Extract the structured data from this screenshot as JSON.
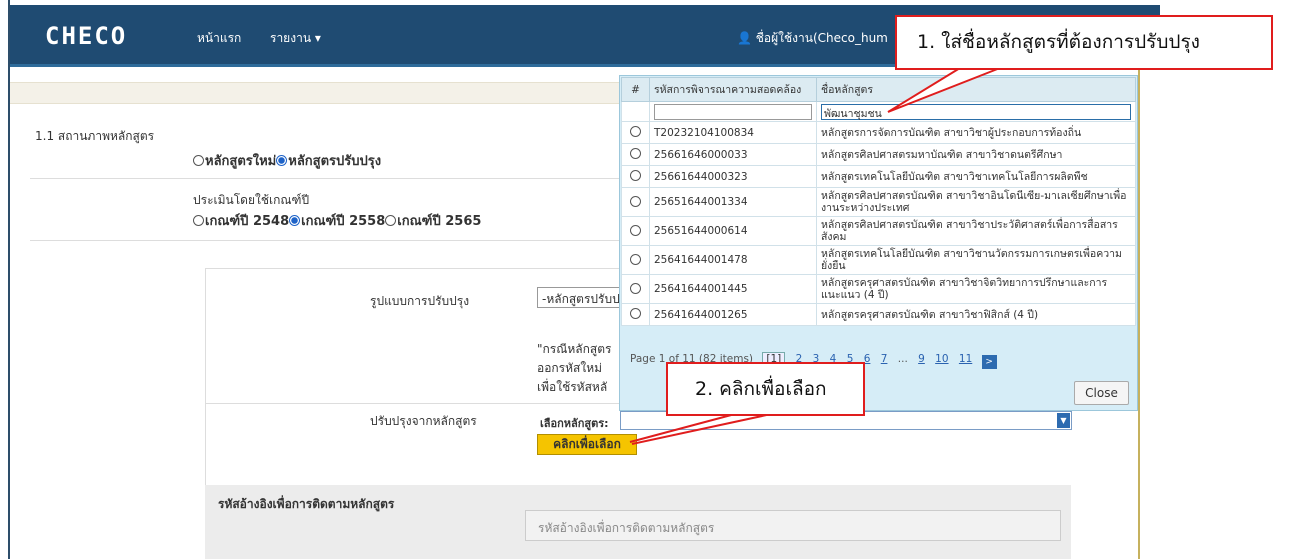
{
  "navbar": {
    "brand": "CHECO",
    "home": "หน้าแรก",
    "report": "รายงาน ▾",
    "user_text": "ชื่อผู้ใช้งาน(Checo_hum"
  },
  "form": {
    "status_label": "1.1 สถานภาพหลักสูตร",
    "status_new": "หลักสูตรใหม่",
    "status_revised": "หลักสูตรปรับปรุง",
    "criteria_label": "ประเมินโดยใช้เกณฑ์ปี",
    "criteria_options": [
      "เกณฑ์ปี 2548",
      "เกณฑ์ปี 2558",
      "เกณฑ์ปี 2565"
    ],
    "improve_type_label": "รูปแบบการปรับปรุง",
    "improve_type_value": "-หลักสูตรปรับป",
    "note_lines": [
      "\"กรณีหลักสูตร",
      "ออกรหัสใหม่ ",
      "เพื่อใช้รหัสหลั"
    ],
    "improve_from_label": "ปรับปรุงจากหลักสูตร",
    "pick_label": "เลือกหลักสูตร:",
    "pick_button": "คลิกเพื่อเลือก",
    "ref_label": "รหัสอ้างอิงเพื่อการติดตามหลักสูตร",
    "ref_placeholder": "รหัสอ้างอิงเพื่อการติดตามหลักสูตร"
  },
  "popup": {
    "headers": [
      "#",
      "รหัสการพิจารณาความสอดคล้อง",
      "ชื่อหลักสูตร"
    ],
    "filter_name_value": "พัฒนาชุมชน",
    "rows": [
      {
        "code": "T20232104100834",
        "name": "หลักสูตรการจัดการบัณฑิต สาขาวิชาผู้ประกอบการท้องถิ่น"
      },
      {
        "code": "25661646000033",
        "name": "หลักสูตรศิลปศาสตรมหาบัณฑิต สาขาวิชาดนตรีศึกษา"
      },
      {
        "code": "25661644000323",
        "name": "หลักสูตรเทคโนโลยีบัณฑิต สาขาวิชาเทคโนโลยีการผลิตพืช"
      },
      {
        "code": "25651644001334",
        "name": "หลักสูตรศิลปศาสตรบัณฑิต สาขาวิชาอินโดนีเซีย-มาเลเซียศึกษาเพื่องานระหว่างประเทศ"
      },
      {
        "code": "25651644000614",
        "name": "หลักสูตรศิลปศาสตรบัณฑิต สาขาวิชาประวัติศาสตร์เพื่อการสื่อสารสังคม"
      },
      {
        "code": "25641644001478",
        "name": "หลักสูตรเทคโนโลยีบัณฑิต สาขาวิชานวัตกรรมการเกษตรเพื่อความยั่งยืน"
      },
      {
        "code": "25641644001445",
        "name": "หลักสูตรครุศาสตรบัณฑิต สาขาวิชาจิตวิทยาการปรึกษาและการแนะแนว (4 ปี)"
      },
      {
        "code": "25641644001265",
        "name": "หลักสูตรครุศาสตรบัณฑิต สาขาวิชาฟิสิกส์ (4 ปี)"
      }
    ],
    "pager_text": "Page 1 of 11 (82 items)",
    "pages": [
      "[1]",
      "2",
      "3",
      "4",
      "5",
      "6",
      "7",
      "...",
      "9",
      "10",
      "11"
    ],
    "next": ">",
    "close": "Close"
  },
  "callouts": {
    "step1": "1. ใส่ชื่อหลักสูตรที่ต้องการปรับปรุง",
    "step2": "2. คลิกเพื่อเลือก"
  },
  "colors": {
    "navbar": "#1f4b72",
    "callout_border": "#e01d1d",
    "button_yellow": "#f5c400",
    "popup_bg": "#d6edf7"
  }
}
